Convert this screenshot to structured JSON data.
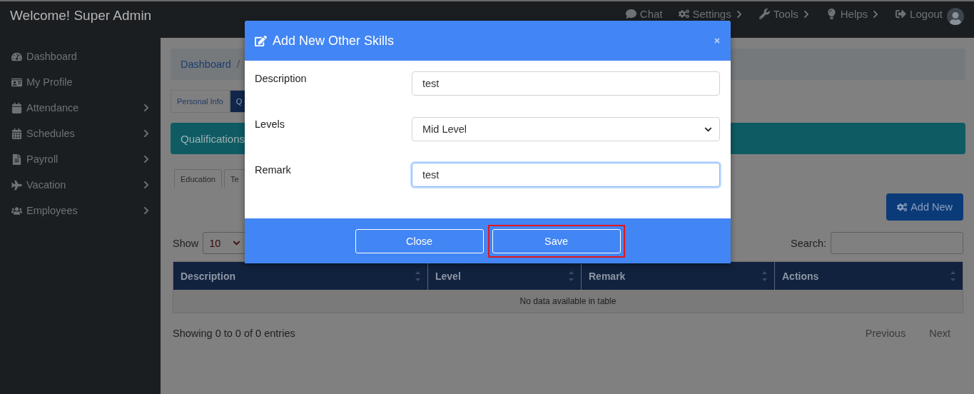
{
  "topbar": {
    "title": "Welcome! Super Admin",
    "nav": [
      {
        "label": "Chat",
        "expandable": false
      },
      {
        "label": "Settings",
        "expandable": true
      },
      {
        "label": "Tools",
        "expandable": true
      },
      {
        "label": "Helps",
        "expandable": true
      },
      {
        "label": "Logout",
        "expandable": false
      }
    ]
  },
  "sidebar": {
    "items": [
      {
        "label": "Dashboard",
        "expandable": false
      },
      {
        "label": "My Profile",
        "expandable": false
      },
      {
        "label": "Attendance",
        "expandable": true
      },
      {
        "label": "Schedules",
        "expandable": true
      },
      {
        "label": "Payroll",
        "expandable": true
      },
      {
        "label": "Vacation",
        "expandable": true
      },
      {
        "label": "Employees",
        "expandable": true
      }
    ]
  },
  "breadcrumb": {
    "items": [
      "Dashboard"
    ],
    "separator": "/"
  },
  "tabs": [
    {
      "label": "Personal Info",
      "selected": false
    },
    {
      "label": "Q",
      "selected": true
    }
  ],
  "section_title": "Qualifications",
  "subtabs": [
    {
      "label": "Education",
      "selected": false
    },
    {
      "label": "Te",
      "selected": false
    }
  ],
  "add_button": "Add New",
  "length": {
    "label": "Show",
    "value": "10"
  },
  "search": {
    "label": "Search:"
  },
  "table": {
    "columns": [
      "Description",
      "Level",
      "Remark",
      "Actions"
    ],
    "empty": "No data available in table"
  },
  "info": "Showing 0 to 0 of 0 entries",
  "pagination": [
    "Previous",
    "Next"
  ],
  "modal": {
    "title": "Add New Other Skills",
    "fields": [
      {
        "kind": "text",
        "label": "Description",
        "value": "test",
        "focused": false
      },
      {
        "kind": "select",
        "label": "Levels",
        "value": "Mid Level",
        "focused": false
      },
      {
        "kind": "text",
        "label": "Remark",
        "value": "test",
        "focused": true
      }
    ],
    "buttons": [
      {
        "label": "Close",
        "highlighted": false
      },
      {
        "label": "Save",
        "highlighted": true
      }
    ]
  }
}
